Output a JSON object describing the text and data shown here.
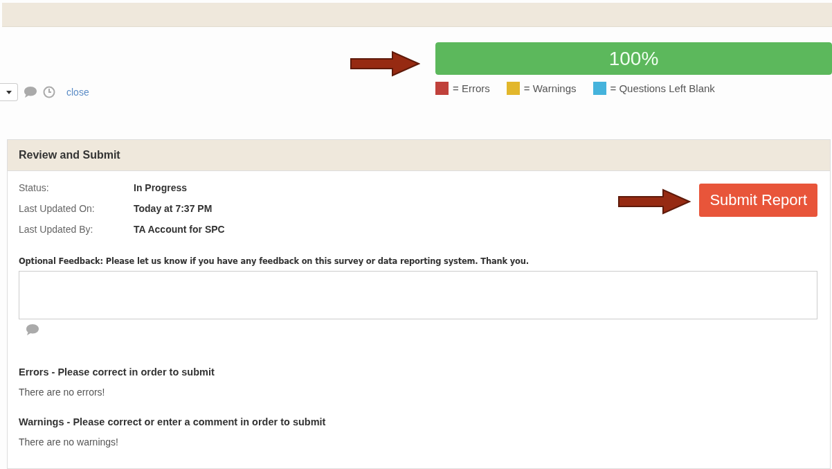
{
  "toolbar": {
    "close_link": "close"
  },
  "progress": {
    "level": 1,
    "label": "100%"
  },
  "legend": [
    {
      "label": "= Errors",
      "color": "#c0413b"
    },
    {
      "label": "= Warnings",
      "color": "#e2b72c"
    },
    {
      "label": "= Questions Left Blank",
      "color": "#45b3dc"
    }
  ],
  "panel": {
    "title": "Review and Submit",
    "fields": [
      {
        "label": "Status:",
        "value": "In Progress"
      },
      {
        "label": "Last Updated On:",
        "value": "Today at 7:37 PM"
      },
      {
        "label": "Last Updated By:",
        "value": "TA Account for SPC"
      }
    ],
    "submit_button": "Submit Report",
    "feedback": {
      "label": "Optional Feedback: Please let us know if you have any feedback on this survey or data reporting system. Thank you."
    },
    "sections": [
      {
        "heading": "Errors - Please correct in order to submit",
        "message": "There are no errors!"
      },
      {
        "heading": "Warnings - Please correct or enter a comment in order to submit",
        "message": "There are no warnings!"
      }
    ]
  }
}
